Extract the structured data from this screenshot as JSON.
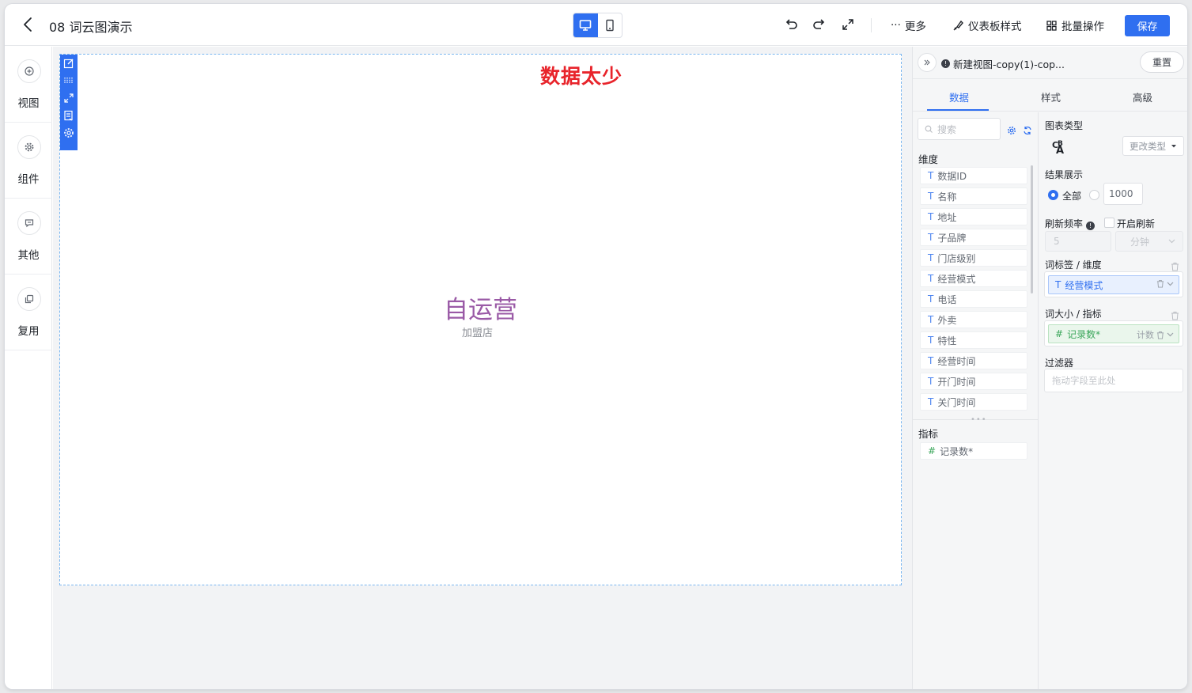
{
  "header": {
    "title": "08 词云图演示",
    "more_label": "更多",
    "dashboard_style_label": "仪表板样式",
    "batch_label": "批量操作",
    "save_label": "保存"
  },
  "left_sidebar": {
    "items": [
      {
        "label": "视图",
        "icon": "plus-circle-icon"
      },
      {
        "label": "组件",
        "icon": "gear-icon"
      },
      {
        "label": "其他",
        "icon": "chat-icon"
      },
      {
        "label": "复用",
        "icon": "copy-icon"
      }
    ]
  },
  "canvas": {
    "annotation": "数据太少",
    "words": [
      {
        "text": "自运营",
        "color": "#9a5aa6"
      },
      {
        "text": "加盟店",
        "color": "#8c8f96"
      }
    ]
  },
  "panel": {
    "view_name": "新建视图-copy(1)-cop...",
    "reset_label": "重置",
    "tabs": [
      "数据",
      "样式",
      "高级"
    ],
    "active_tab": "数据",
    "search_placeholder": "搜索",
    "dimensions_label": "维度",
    "dimensions": [
      "数据ID",
      "名称",
      "地址",
      "子品牌",
      "门店级别",
      "经营模式",
      "电话",
      "外卖",
      "特性",
      "经营时间",
      "开门时间",
      "关门时间"
    ],
    "metrics_label": "指标",
    "metrics": [
      "记录数*"
    ],
    "chart_type_label": "图表类型",
    "change_type_label": "更改类型",
    "result_label": "结果展示",
    "result_all_label": "全部",
    "result_limit": "1000",
    "refresh_label": "刷新频率",
    "refresh_enable_label": "开启刷新",
    "refresh_value": "5",
    "refresh_unit": "分钟",
    "word_label_title": "词标签 / 维度",
    "word_label_field": "经营模式",
    "word_size_title": "词大小 / 指标",
    "word_size_field": "记录数*",
    "word_size_agg": "计数",
    "filter_label": "过滤器",
    "filter_placeholder": "拖动字段至此处"
  },
  "colors": {
    "accent": "#2f6ff0",
    "annotation": "#e8242b"
  }
}
